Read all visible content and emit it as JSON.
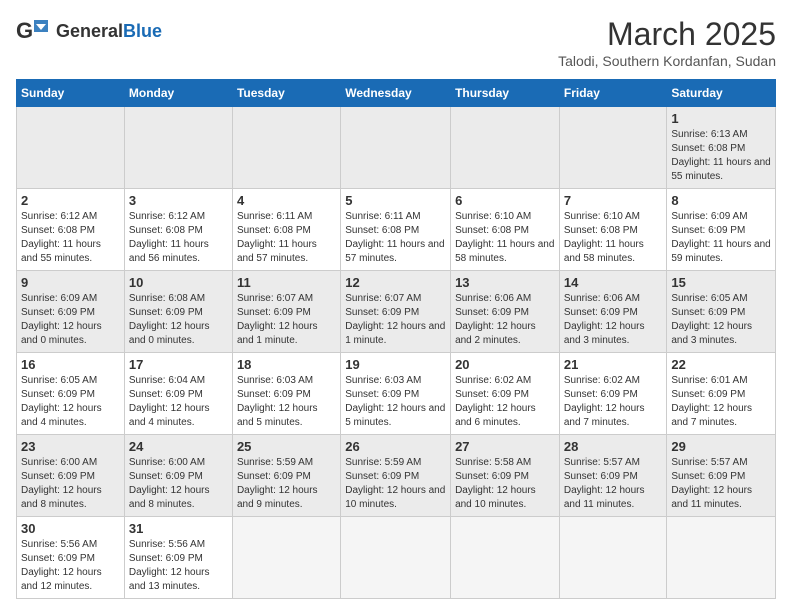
{
  "header": {
    "logo_text_general": "General",
    "logo_text_blue": "Blue",
    "month_year": "March 2025",
    "location": "Talodi, Southern Kordanfan, Sudan"
  },
  "days_of_week": [
    "Sunday",
    "Monday",
    "Tuesday",
    "Wednesday",
    "Thursday",
    "Friday",
    "Saturday"
  ],
  "weeks": [
    [
      {
        "day": "",
        "info": ""
      },
      {
        "day": "",
        "info": ""
      },
      {
        "day": "",
        "info": ""
      },
      {
        "day": "",
        "info": ""
      },
      {
        "day": "",
        "info": ""
      },
      {
        "day": "",
        "info": ""
      },
      {
        "day": "1",
        "info": "Sunrise: 6:13 AM\nSunset: 6:08 PM\nDaylight: 11 hours and 55 minutes."
      }
    ],
    [
      {
        "day": "2",
        "info": "Sunrise: 6:12 AM\nSunset: 6:08 PM\nDaylight: 11 hours and 55 minutes."
      },
      {
        "day": "3",
        "info": "Sunrise: 6:12 AM\nSunset: 6:08 PM\nDaylight: 11 hours and 56 minutes."
      },
      {
        "day": "4",
        "info": "Sunrise: 6:11 AM\nSunset: 6:08 PM\nDaylight: 11 hours and 57 minutes."
      },
      {
        "day": "5",
        "info": "Sunrise: 6:11 AM\nSunset: 6:08 PM\nDaylight: 11 hours and 57 minutes."
      },
      {
        "day": "6",
        "info": "Sunrise: 6:10 AM\nSunset: 6:08 PM\nDaylight: 11 hours and 58 minutes."
      },
      {
        "day": "7",
        "info": "Sunrise: 6:10 AM\nSunset: 6:08 PM\nDaylight: 11 hours and 58 minutes."
      },
      {
        "day": "8",
        "info": "Sunrise: 6:09 AM\nSunset: 6:09 PM\nDaylight: 11 hours and 59 minutes."
      }
    ],
    [
      {
        "day": "9",
        "info": "Sunrise: 6:09 AM\nSunset: 6:09 PM\nDaylight: 12 hours and 0 minutes."
      },
      {
        "day": "10",
        "info": "Sunrise: 6:08 AM\nSunset: 6:09 PM\nDaylight: 12 hours and 0 minutes."
      },
      {
        "day": "11",
        "info": "Sunrise: 6:07 AM\nSunset: 6:09 PM\nDaylight: 12 hours and 1 minute."
      },
      {
        "day": "12",
        "info": "Sunrise: 6:07 AM\nSunset: 6:09 PM\nDaylight: 12 hours and 1 minute."
      },
      {
        "day": "13",
        "info": "Sunrise: 6:06 AM\nSunset: 6:09 PM\nDaylight: 12 hours and 2 minutes."
      },
      {
        "day": "14",
        "info": "Sunrise: 6:06 AM\nSunset: 6:09 PM\nDaylight: 12 hours and 3 minutes."
      },
      {
        "day": "15",
        "info": "Sunrise: 6:05 AM\nSunset: 6:09 PM\nDaylight: 12 hours and 3 minutes."
      }
    ],
    [
      {
        "day": "16",
        "info": "Sunrise: 6:05 AM\nSunset: 6:09 PM\nDaylight: 12 hours and 4 minutes."
      },
      {
        "day": "17",
        "info": "Sunrise: 6:04 AM\nSunset: 6:09 PM\nDaylight: 12 hours and 4 minutes."
      },
      {
        "day": "18",
        "info": "Sunrise: 6:03 AM\nSunset: 6:09 PM\nDaylight: 12 hours and 5 minutes."
      },
      {
        "day": "19",
        "info": "Sunrise: 6:03 AM\nSunset: 6:09 PM\nDaylight: 12 hours and 5 minutes."
      },
      {
        "day": "20",
        "info": "Sunrise: 6:02 AM\nSunset: 6:09 PM\nDaylight: 12 hours and 6 minutes."
      },
      {
        "day": "21",
        "info": "Sunrise: 6:02 AM\nSunset: 6:09 PM\nDaylight: 12 hours and 7 minutes."
      },
      {
        "day": "22",
        "info": "Sunrise: 6:01 AM\nSunset: 6:09 PM\nDaylight: 12 hours and 7 minutes."
      }
    ],
    [
      {
        "day": "23",
        "info": "Sunrise: 6:00 AM\nSunset: 6:09 PM\nDaylight: 12 hours and 8 minutes."
      },
      {
        "day": "24",
        "info": "Sunrise: 6:00 AM\nSunset: 6:09 PM\nDaylight: 12 hours and 8 minutes."
      },
      {
        "day": "25",
        "info": "Sunrise: 5:59 AM\nSunset: 6:09 PM\nDaylight: 12 hours and 9 minutes."
      },
      {
        "day": "26",
        "info": "Sunrise: 5:59 AM\nSunset: 6:09 PM\nDaylight: 12 hours and 10 minutes."
      },
      {
        "day": "27",
        "info": "Sunrise: 5:58 AM\nSunset: 6:09 PM\nDaylight: 12 hours and 10 minutes."
      },
      {
        "day": "28",
        "info": "Sunrise: 5:57 AM\nSunset: 6:09 PM\nDaylight: 12 hours and 11 minutes."
      },
      {
        "day": "29",
        "info": "Sunrise: 5:57 AM\nSunset: 6:09 PM\nDaylight: 12 hours and 11 minutes."
      }
    ],
    [
      {
        "day": "30",
        "info": "Sunrise: 5:56 AM\nSunset: 6:09 PM\nDaylight: 12 hours and 12 minutes."
      },
      {
        "day": "31",
        "info": "Sunrise: 5:56 AM\nSunset: 6:09 PM\nDaylight: 12 hours and 13 minutes."
      },
      {
        "day": "",
        "info": ""
      },
      {
        "day": "",
        "info": ""
      },
      {
        "day": "",
        "info": ""
      },
      {
        "day": "",
        "info": ""
      },
      {
        "day": "",
        "info": ""
      }
    ]
  ]
}
